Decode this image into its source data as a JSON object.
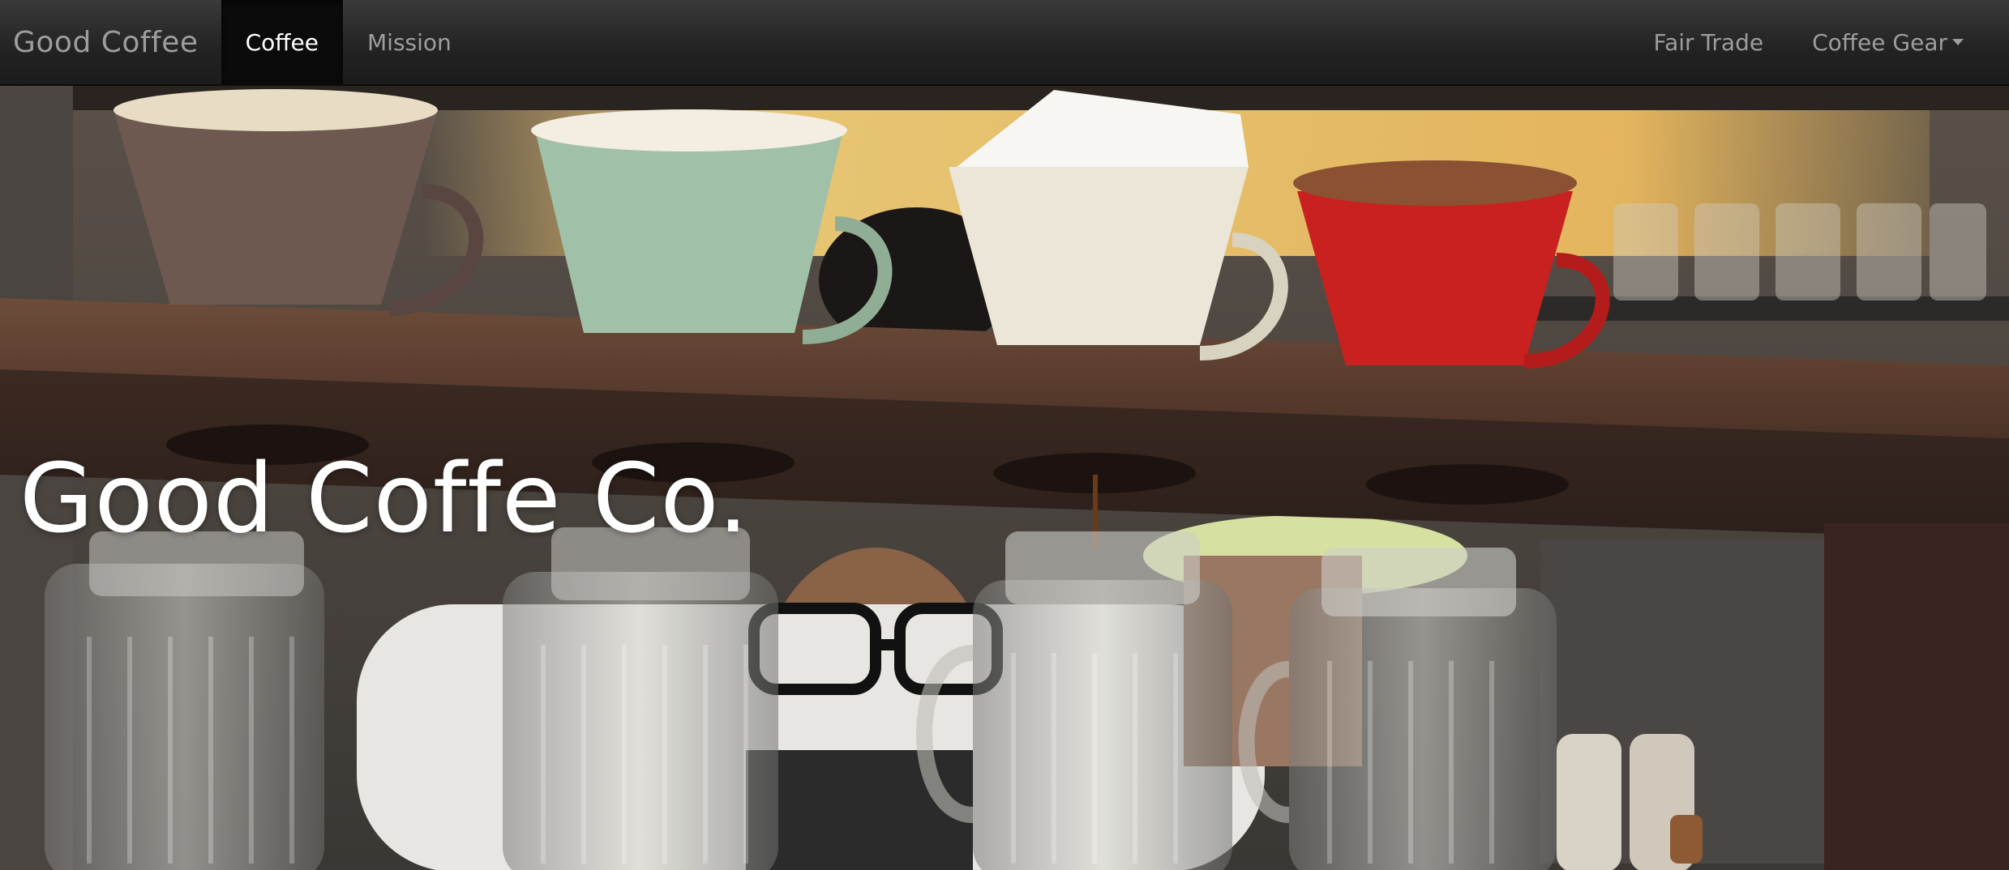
{
  "navbar": {
    "brand": "Good Coffee",
    "left_items": [
      {
        "label": "Coffee",
        "active": true
      },
      {
        "label": "Mission",
        "active": false
      }
    ],
    "right_items": [
      {
        "label": "Fair Trade"
      },
      {
        "label": "Coffee Gear",
        "has_dropdown": true
      }
    ]
  },
  "hero": {
    "title": "Good Coffe Co."
  },
  "colors": {
    "navbar_bg": "#222222",
    "navbar_text": "#9d9d9d",
    "active_bg": "#0b0b0b",
    "title_text": "#ffffff"
  }
}
